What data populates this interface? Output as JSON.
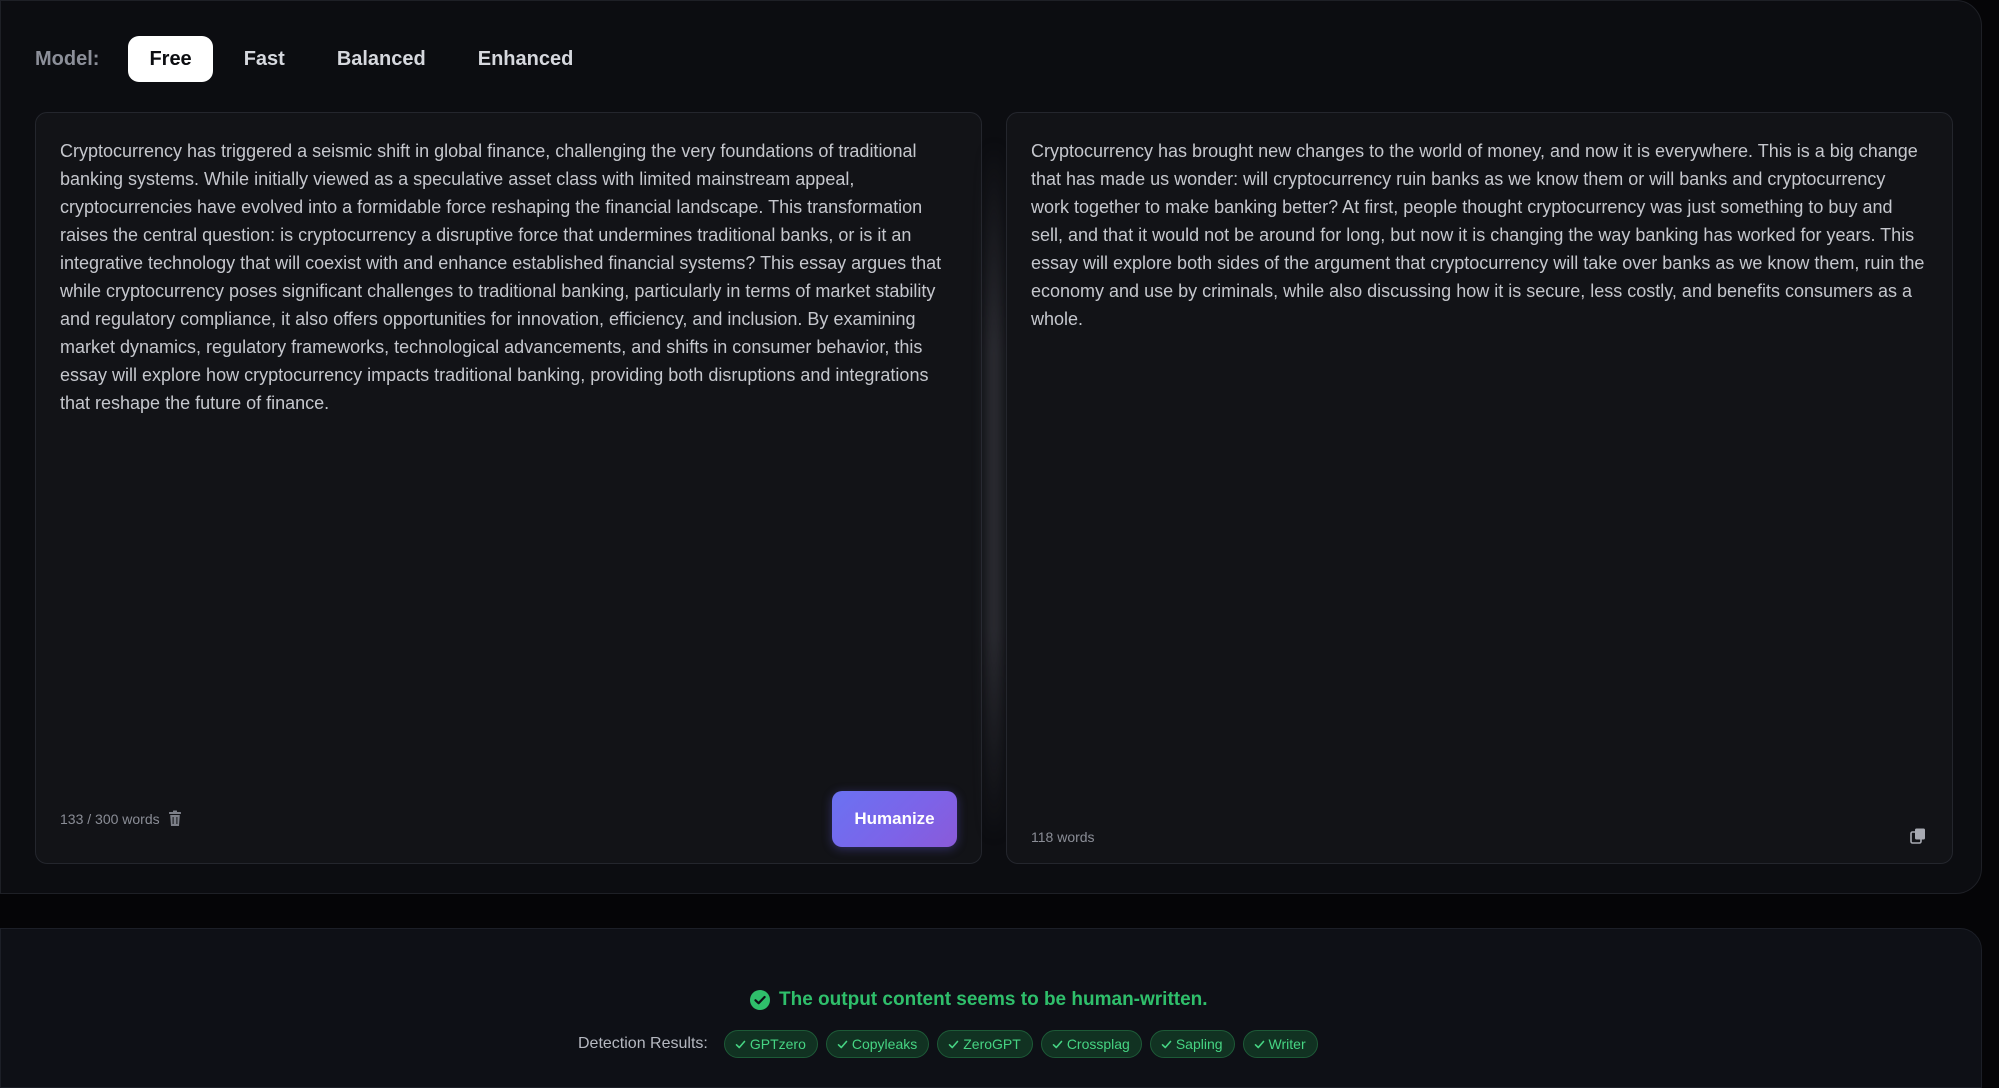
{
  "model": {
    "label": "Model:",
    "tabs": [
      {
        "label": "Free",
        "active": true
      },
      {
        "label": "Fast",
        "active": false
      },
      {
        "label": "Balanced",
        "active": false
      },
      {
        "label": "Enhanced",
        "active": false
      }
    ]
  },
  "input": {
    "text": "Cryptocurrency has triggered a seismic shift in global finance, challenging the very foundations of traditional banking systems. While initially viewed as a speculative asset class with limited mainstream appeal, cryptocurrencies have evolved into a formidable force reshaping the financial landscape. This transformation raises the central question: is cryptocurrency a disruptive force that undermines traditional banks, or is it an integrative technology that will coexist with and enhance established financial systems? This essay argues that while cryptocurrency poses significant challenges to traditional banking, particularly in terms of market stability and regulatory compliance, it also offers opportunities for innovation, efficiency, and inclusion. By examining market dynamics, regulatory frameworks, technological advancements, and shifts in consumer behavior, this essay will explore how cryptocurrency impacts traditional banking, providing both disruptions and integrations that reshape the future of finance.",
    "word_count": "133 / 300 words",
    "humanize_label": "Humanize",
    "accent_color": "#6a72f2"
  },
  "output": {
    "text": "Cryptocurrency has brought new changes to the world of money, and now it is everywhere. This is a big change that has made us wonder: will cryptocurrency ruin banks as we know them or will banks and cryptocurrency work together to make banking better? At first, people thought cryptocurrency was just something to buy and sell, and that it would not be around for long, but now it is changing the way banking has worked for years. This essay will explore both sides of the argument that cryptocurrency will take over banks as we know them, ruin the economy and use by criminals, while also discussing how it is secure, less costly, and benefits consumers as a whole.",
    "word_count": "118 words"
  },
  "results": {
    "status_text": "The output content seems to be human-written.",
    "status_color": "#2fbf6b",
    "detection_label": "Detection Results:",
    "detectors": [
      "GPTzero",
      "Copyleaks",
      "ZeroGPT",
      "Crossplag",
      "Sapling",
      "Writer"
    ]
  },
  "icons": {
    "delete": "trash-icon",
    "copy": "copy-icon",
    "status": "check-circle-icon",
    "badge": "check-icon"
  }
}
